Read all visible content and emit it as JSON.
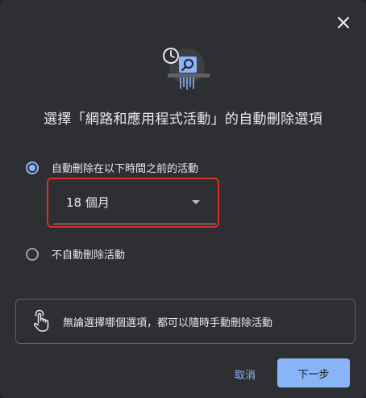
{
  "dialog": {
    "title": "選擇「網路和應用程式活動」的自動刪除選項",
    "close_icon": "close-icon",
    "illustration_icon": "history-delete-icon",
    "options": [
      {
        "label": "自動刪除在以下時間之前的活動",
        "checked": true
      },
      {
        "label": "不自動刪除活動",
        "checked": false
      }
    ],
    "period_select": {
      "value": "18 個月",
      "icon": "dropdown-arrow-icon"
    },
    "info": {
      "icon": "touch-hand-icon",
      "text": "無論選擇哪個選項，都可以隨時手動刪除活動"
    },
    "buttons": {
      "cancel": "取消",
      "next": "下一步"
    }
  },
  "colors": {
    "background": "#2e2f32",
    "accent": "#8ab4f8",
    "highlight_border": "#d93025",
    "text": "#e8eaed"
  }
}
